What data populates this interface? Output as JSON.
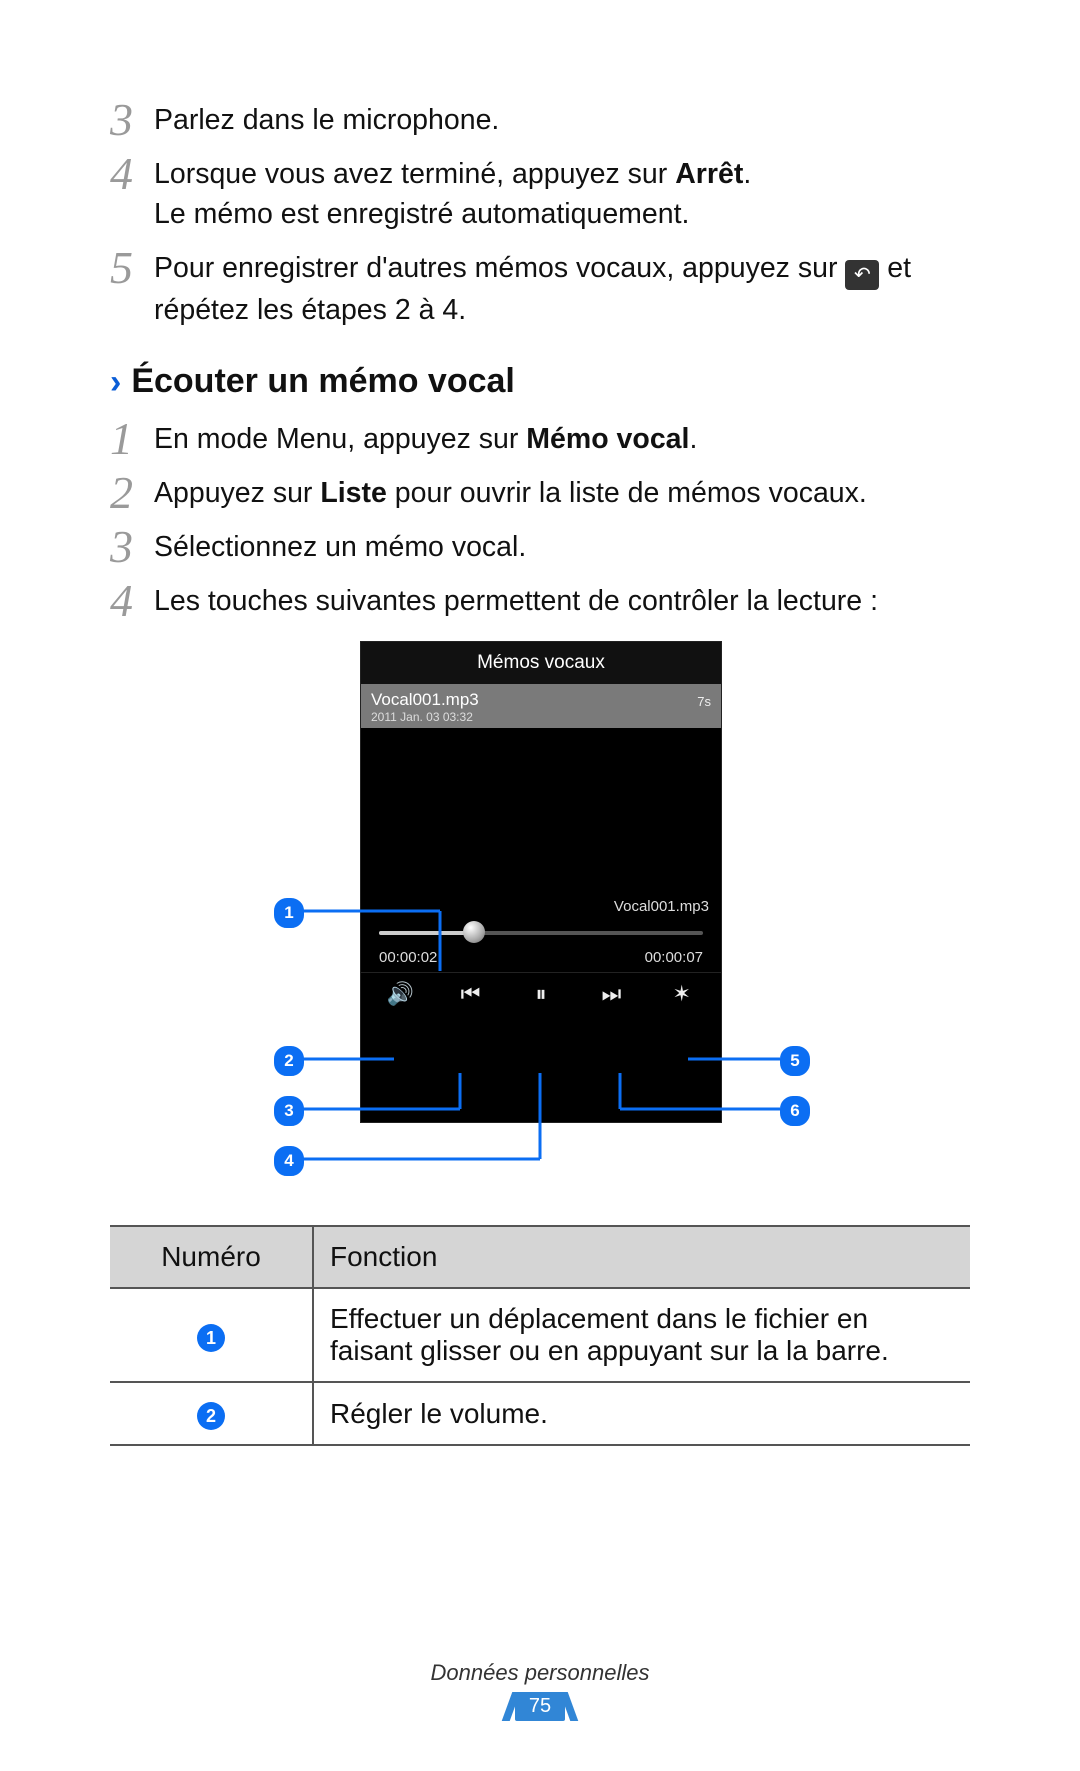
{
  "stepsA": [
    {
      "num": "3",
      "html": "Parlez dans le microphone."
    },
    {
      "num": "4",
      "html": "Lorsque vous avez terminé, appuyez sur <b>Arrêt</b>.<span class=\"line2\">Le mémo est enregistré automatiquement.</span>"
    },
    {
      "num": "5",
      "html": "Pour enregistrer d'autres mémos vocaux, appuyez sur <span class=\"icon-return\" data-name=\"return-icon\" data-interactable=\"false\">↶</span> et répétez les étapes 2 à 4."
    }
  ],
  "section": {
    "title": "Écouter un mémo vocal"
  },
  "stepsB": [
    {
      "num": "1",
      "html": "En mode Menu, appuyez sur <b>Mémo vocal</b>."
    },
    {
      "num": "2",
      "html": "Appuyez sur <b>Liste</b> pour ouvrir la liste de mémos vocaux."
    },
    {
      "num": "3",
      "html": "Sélectionnez un mémo vocal."
    },
    {
      "num": "4",
      "html": "Les touches suivantes permettent de contrôler la lecture :"
    }
  ],
  "screenshot": {
    "title": "Mémos vocaux",
    "item": {
      "name": "Vocal001.mp3",
      "date": "2011 Jan. 03 03:32",
      "duration": "7s"
    },
    "nowPlaying": "Vocal001.mp3",
    "elapsed": "00:00:02",
    "total": "00:00:07"
  },
  "callouts": [
    "1",
    "2",
    "3",
    "4",
    "5",
    "6"
  ],
  "table": {
    "headers": [
      "Numéro",
      "Fonction"
    ],
    "rows": [
      {
        "num": "1",
        "func": "Effectuer un déplacement dans le fichier en faisant glisser ou en appuyant sur la la barre."
      },
      {
        "num": "2",
        "func": "Régler le volume."
      }
    ]
  },
  "footer": {
    "section": "Données personnelles",
    "page": "75"
  }
}
